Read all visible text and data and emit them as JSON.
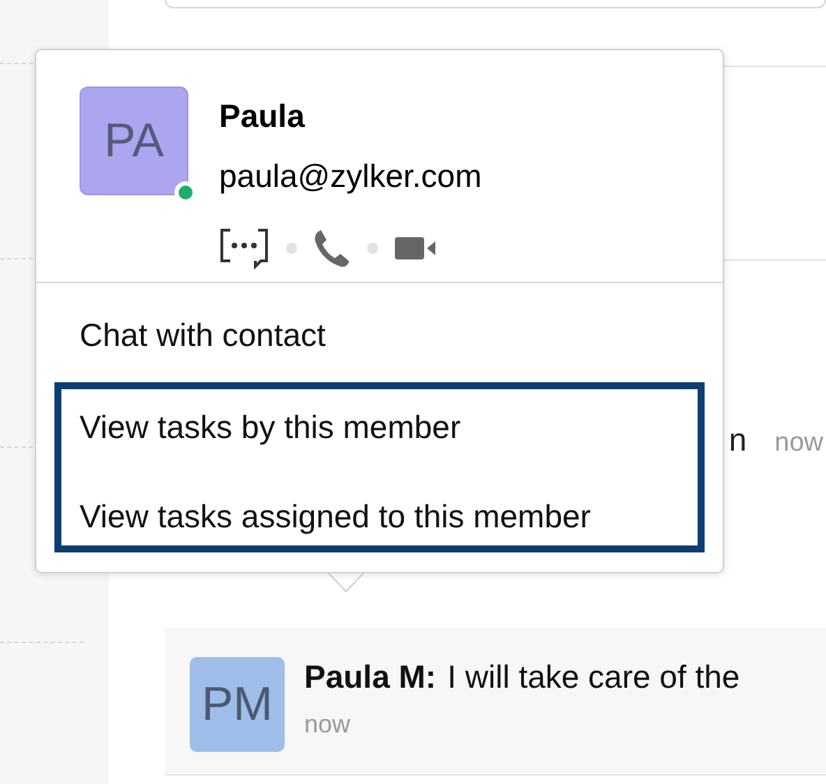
{
  "popover": {
    "name": "Paula",
    "email": "paula@zylker.com",
    "avatar": "PA",
    "online": true,
    "menu": [
      {
        "label": "Chat with contact",
        "highlighted": false
      },
      {
        "label": "View tasks by this member",
        "highlighted": true
      },
      {
        "label": "View tasks assigned to this member",
        "highlighted": true
      }
    ]
  },
  "background_row": {
    "text": "n",
    "time": "now"
  },
  "message": {
    "avatar": "PM",
    "sender": "Paula M:",
    "text": "I will take care of the",
    "time": "now"
  }
}
